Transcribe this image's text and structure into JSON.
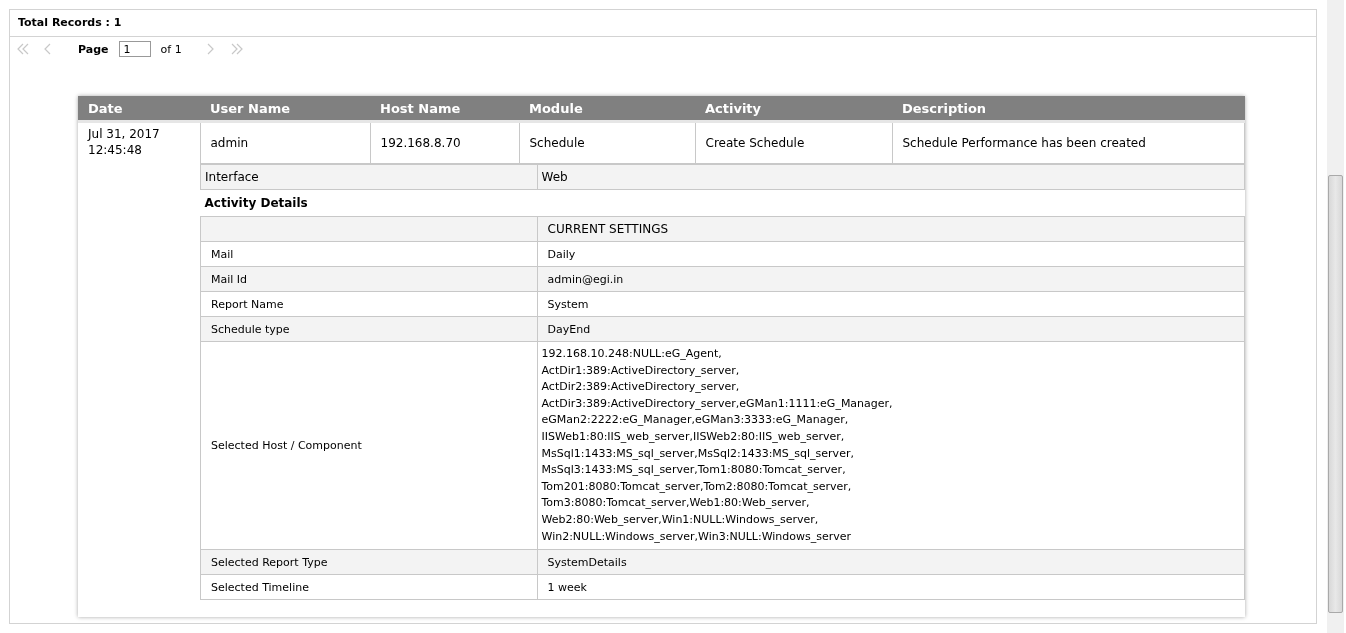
{
  "summary": {
    "total_records": "Total Records : 1"
  },
  "pager": {
    "nav": [
      {
        "kind": "first",
        "disabled": true
      },
      {
        "kind": "prev",
        "disabled": true
      }
    ],
    "page_label": "Page",
    "page_value": "1",
    "of_label": "of 1",
    "nav_after": [
      {
        "kind": "next",
        "disabled": true
      },
      {
        "kind": "last",
        "disabled": true
      }
    ]
  },
  "table": {
    "columns": [
      "Date",
      "User Name",
      "Host Name",
      "Module",
      "Activity",
      "Description"
    ],
    "rows": [
      {
        "cells": [
          "Jul 31, 2017 12:45:48",
          "admin",
          "192.168.8.70",
          "Schedule",
          "Create Schedule",
          "Schedule Performance has been created"
        ],
        "interface": {
          "label": "Interface",
          "value": "Web"
        },
        "details_title": "Activity Details",
        "details_header": "CURRENT SETTINGS",
        "details": [
          {
            "label": "Mail",
            "value": "Daily"
          },
          {
            "label": "Mail Id",
            "value": "admin@egi.in"
          },
          {
            "label": "Report Name",
            "value": "System"
          },
          {
            "label": "Schedule type",
            "value": "DayEnd"
          },
          {
            "label": "Selected Host / Component",
            "value": "192.168.10.248:NULL:eG_Agent,\nActDir1:389:ActiveDirectory_server,\nActDir2:389:ActiveDirectory_server,\nActDir3:389:ActiveDirectory_server,eGMan1:1111:eG_Manager,\neGMan2:2222:eG_Manager,eGMan3:3333:eG_Manager,\nIISWeb1:80:IIS_web_server,IISWeb2:80:IIS_web_server,\nMsSql1:1433:MS_sql_server,MsSql2:1433:MS_sql_server,\nMsSql3:1433:MS_sql_server,Tom1:8080:Tomcat_server,\nTom201:8080:Tomcat_server,Tom2:8080:Tomcat_server,\nTom3:8080:Tomcat_server,Web1:80:Web_server,\nWeb2:80:Web_server,Win1:NULL:Windows_server,\nWin2:NULL:Windows_server,Win3:NULL:Windows_server"
          },
          {
            "label": "Selected Report Type",
            "value": "SystemDetails"
          },
          {
            "label": "Selected Timeline",
            "value": "1 week"
          }
        ]
      }
    ]
  }
}
